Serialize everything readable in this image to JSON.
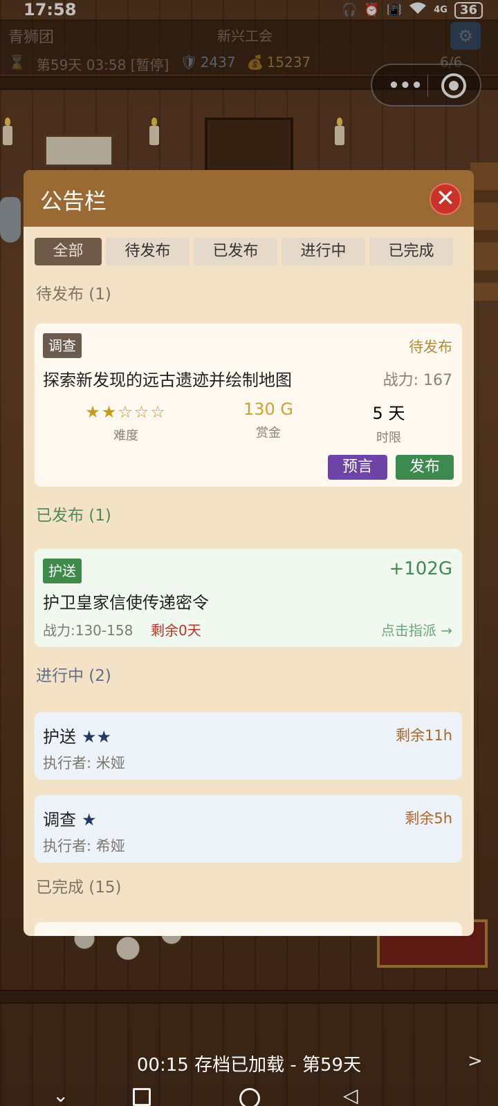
{
  "status_bar": {
    "time": "17:58",
    "icons": [
      "headphones-icon",
      "alarm-icon",
      "vibrate-icon",
      "wifi-icon",
      "signal-4g-icon"
    ],
    "network": "4G",
    "battery": "36"
  },
  "hud": {
    "team_name": "青狮团",
    "guild_name": "新兴工会",
    "day_time": "第59天 03:58 [暂停]",
    "shield_value": "2437",
    "gold_value": "15237",
    "staff_count": "6/6"
  },
  "capsule": {
    "more": "•••"
  },
  "modal": {
    "title": "公告栏",
    "close": "✕",
    "tabs": [
      "全部",
      "待发布",
      "已发布",
      "进行中",
      "已完成"
    ],
    "active_tab": "全部",
    "sections": {
      "pending": {
        "title": "待发布 (1)",
        "card": {
          "tag": "调查",
          "status": "待发布",
          "name": "探索新发现的远古遗迹并绘制地图",
          "power": "战力: 167",
          "difficulty": "★★☆☆☆",
          "difficulty_label": "难度",
          "reward": "130 G",
          "reward_label": "赏金",
          "deadline": "5 天",
          "deadline_label": "时限",
          "prophecy_button": "预言",
          "publish_button": "发布"
        }
      },
      "published": {
        "title": "已发布 (1)",
        "card": {
          "tag": "护送",
          "reward": "+102G",
          "name": "护卫皇家信使传递密令",
          "power": "战力:130-158",
          "remaining": "剩余0天",
          "assign": "点击指派 →"
        }
      },
      "in_progress": {
        "title": "进行中 (2)",
        "cards": [
          {
            "name": "护送",
            "stars": "★★",
            "time": "剩余11h",
            "executor": "执行者: 米娅"
          },
          {
            "name": "调查",
            "stars": "★",
            "time": "剩余5h",
            "executor": "执行者: 希娅"
          }
        ]
      },
      "completed": {
        "title": "已完成 (15)"
      }
    }
  },
  "toast": "00:15 存档已加载 - 第59天",
  "next_arrow": ">",
  "nav": {
    "back_hide": "⌄",
    "back": "◁"
  },
  "colors": {
    "modal_header": "#9b6a34",
    "modal_body": "#f3e2c5",
    "close_button": "#c9322a",
    "prophecy_button": "#6d43a8",
    "publish_button": "#3c8a4e",
    "reward_gold": "#d4a029",
    "published_green": "#3f8a4a",
    "remaining_red": "#b8342a"
  }
}
